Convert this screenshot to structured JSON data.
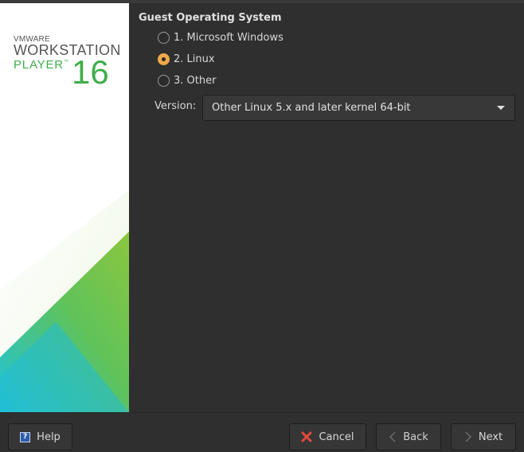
{
  "banner": {
    "brand_small": "VMWARE",
    "brand_product": "WORKSTATION",
    "brand_edition": "PLAYER",
    "brand_tm": "™",
    "brand_version": "16",
    "colors": {
      "green": "#3fae49",
      "light_green": "#8cc63f",
      "teal": "#1fb9c9",
      "blue": "#29b6e6"
    }
  },
  "guest_os": {
    "title": "Guest Operating System",
    "options": [
      {
        "label": "1. Microsoft Windows",
        "checked": false
      },
      {
        "label": "2. Linux",
        "checked": true
      },
      {
        "label": "3. Other",
        "checked": false
      }
    ],
    "version_label": "Version:",
    "version_value": "Other Linux 5.x and later kernel 64-bit"
  },
  "buttons": {
    "help": "Help",
    "cancel": "Cancel",
    "back": "Back",
    "next": "Next"
  },
  "icons": {
    "help": "help-icon",
    "cancel": "cancel-x-icon",
    "back": "chevron-left-icon",
    "next": "chevron-right-icon",
    "dropdown": "caret-down-icon"
  },
  "accent_color": "#f0a94a"
}
